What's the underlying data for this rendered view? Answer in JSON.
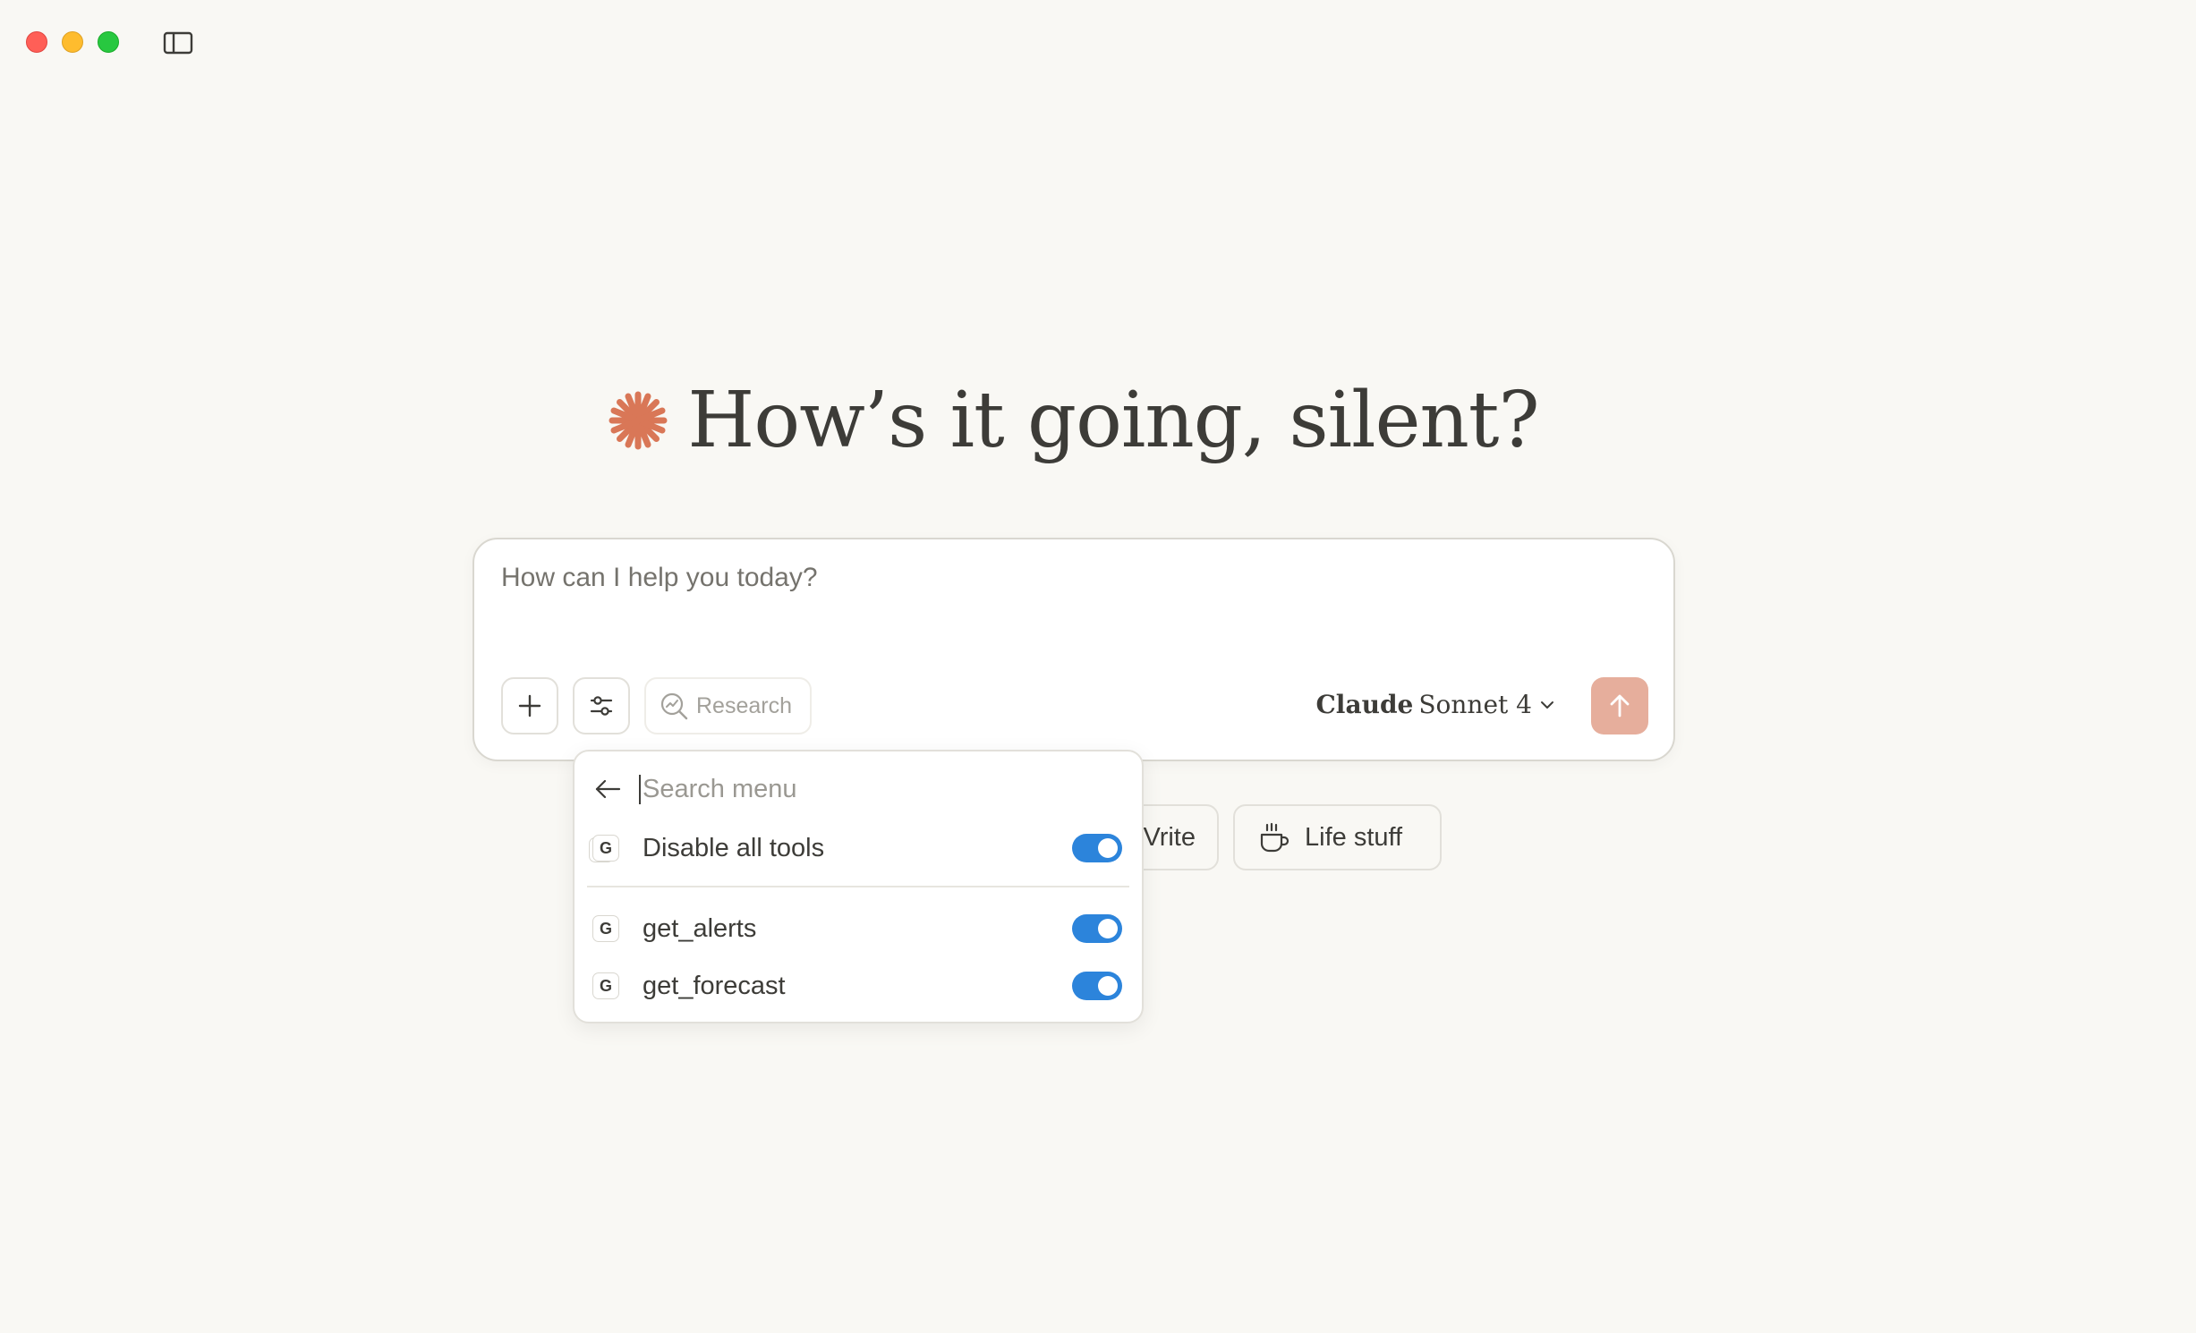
{
  "window": {
    "controls": [
      "close",
      "minimize",
      "zoom"
    ],
    "sidebar_toggle_icon": "sidebar-icon"
  },
  "greeting": {
    "icon": "claude-starburst-icon",
    "text": "How’s it going, silent?"
  },
  "composer": {
    "placeholder": "How can I help you today?",
    "value": "",
    "add_icon": "plus-icon",
    "tools_icon": "sliders-icon",
    "research_label": "Research",
    "research_icon": "research-icon",
    "model": {
      "brand": "Claude",
      "name": "Sonnet 4"
    },
    "send_icon": "arrow-up-icon"
  },
  "quick_actions": [
    {
      "label": "Write",
      "visible_label": "Vrite",
      "icon": "pen-icon"
    },
    {
      "label": "Life stuff",
      "icon": "coffee-cup-icon"
    }
  ],
  "tools_menu": {
    "search_placeholder": "Search menu",
    "search_value": "",
    "items": [
      {
        "label": "Disable all tools",
        "badge": "G",
        "enabled": true
      },
      {
        "label": "get_alerts",
        "badge": "G",
        "enabled": true
      },
      {
        "label": "get_forecast",
        "badge": "G",
        "enabled": true
      }
    ]
  },
  "colors": {
    "background": "#f9f8f4",
    "accent": "#d97757",
    "send_button": "#e6ae9c",
    "toggle_on": "#2c84db",
    "text": "#3d3c38"
  }
}
